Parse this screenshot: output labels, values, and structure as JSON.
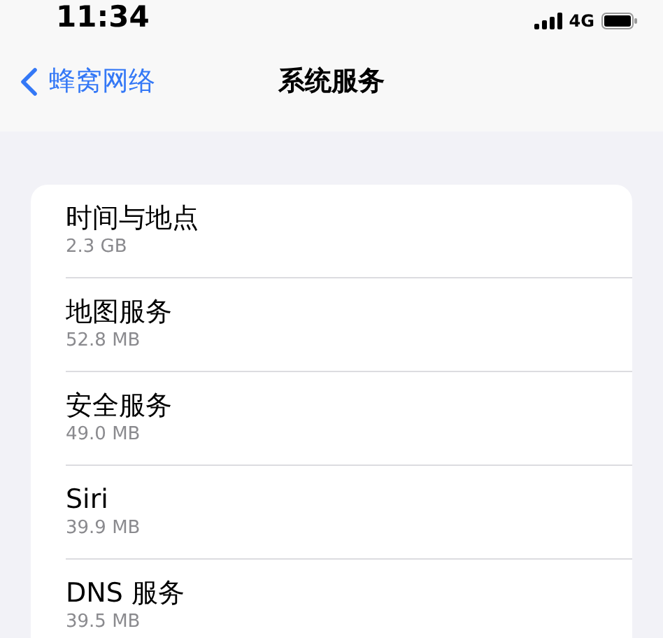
{
  "status_bar": {
    "time": "11:34",
    "network": "4G"
  },
  "nav": {
    "back_label": "蜂窝网络",
    "title": "系统服务"
  },
  "items": [
    {
      "name": "时间与地点",
      "usage": "2.3 GB"
    },
    {
      "name": "地图服务",
      "usage": "52.8 MB"
    },
    {
      "name": "安全服务",
      "usage": "49.0 MB"
    },
    {
      "name": "Siri",
      "usage": "39.9 MB"
    },
    {
      "name": "DNS 服务",
      "usage": "39.5 MB"
    }
  ]
}
